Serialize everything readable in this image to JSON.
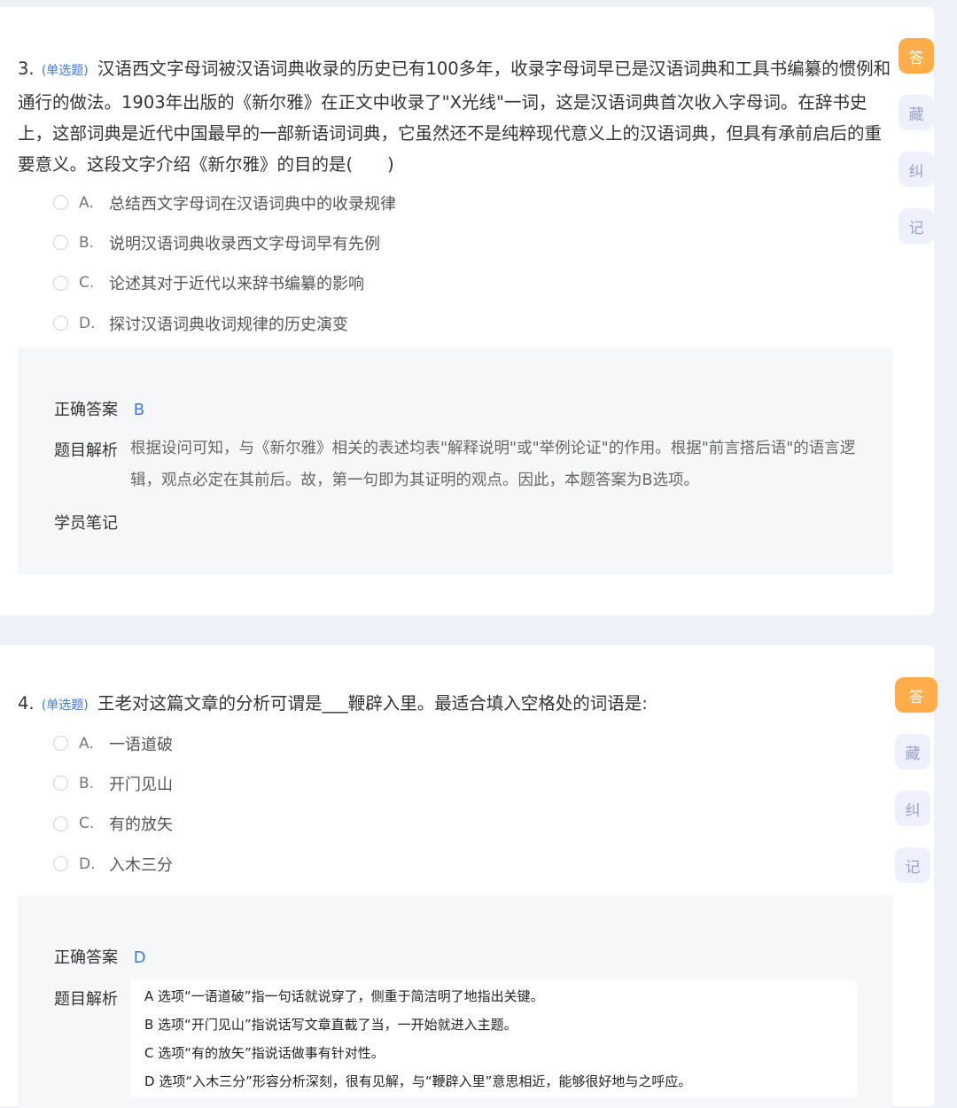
{
  "q3": {
    "number": "3.",
    "type_label": "(单选题)",
    "stem": "汉语西文字母词被汉语词典收录的历史已有100多年，收录字母词早已是汉语词典和工具书编纂的惯例和通行的做法。1903年出版的《新尔雅》在正文中收录了\"X光线\"一词，这是汉语词典首次收入字母词。在辞书史上，这部词典是近代中国最早的一部新语词词典，它虽然还不是纯粹现代意义上的汉语词典，但具有承前启后的重要意义。这段文字介绍《新尔雅》的目的是(　　)",
    "options": [
      {
        "letter": "A.",
        "text": "总结西文字母词在汉语词典中的收录规律"
      },
      {
        "letter": "B.",
        "text": "说明汉语词典收录西文字母词早有先例"
      },
      {
        "letter": "C.",
        "text": "论述其对于近代以来辞书编纂的影响"
      },
      {
        "letter": "D.",
        "text": "探讨汉语词典收词规律的历史演变"
      }
    ],
    "answer_label": "正确答案",
    "answer_value": "B",
    "analysis_label": "题目解析",
    "analysis_text": "根据设问可知，与《新尔雅》相关的表述均表\"解释说明\"或\"举例论证\"的作用。根据\"前言搭后语\"的语言逻辑，观点必定在其前后。故，第一句即为其证明的观点。因此，本题答案为B选项。",
    "notes_label": "学员笔记"
  },
  "q4": {
    "number": "4.",
    "type_label": "(单选题)",
    "stem": "王老对这篇文章的分析可谓是___鞭辟入里。最适合填入空格处的词语是:",
    "options": [
      {
        "letter": "A.",
        "text": "一语道破"
      },
      {
        "letter": "B.",
        "text": "开门见山"
      },
      {
        "letter": "C.",
        "text": "有的放矢"
      },
      {
        "letter": "D.",
        "text": "入木三分"
      }
    ],
    "answer_label": "正确答案",
    "answer_value": "D",
    "analysis_label": "题目解析",
    "analysis_lines": [
      "A 选项“一语道破”指一句话就说穿了，侧重于简洁明了地指出关键。",
      "B 选项“开门见山”指说话写文章直截了当，一开始就进入主题。",
      "C 选项“有的放矢”指说话做事有针对性。",
      "D 选项“入木三分”形容分析深刻，很有见解，与“鞭辟入里”意思相近，能够很好地与之呼应。"
    ]
  },
  "side_buttons": {
    "answer": "答",
    "collect": "藏",
    "correct": "纠",
    "note": "记"
  },
  "colors": {
    "accent_orange": "#ffad4a",
    "link_blue": "#3b7bd8",
    "background": "#eef1f8"
  }
}
